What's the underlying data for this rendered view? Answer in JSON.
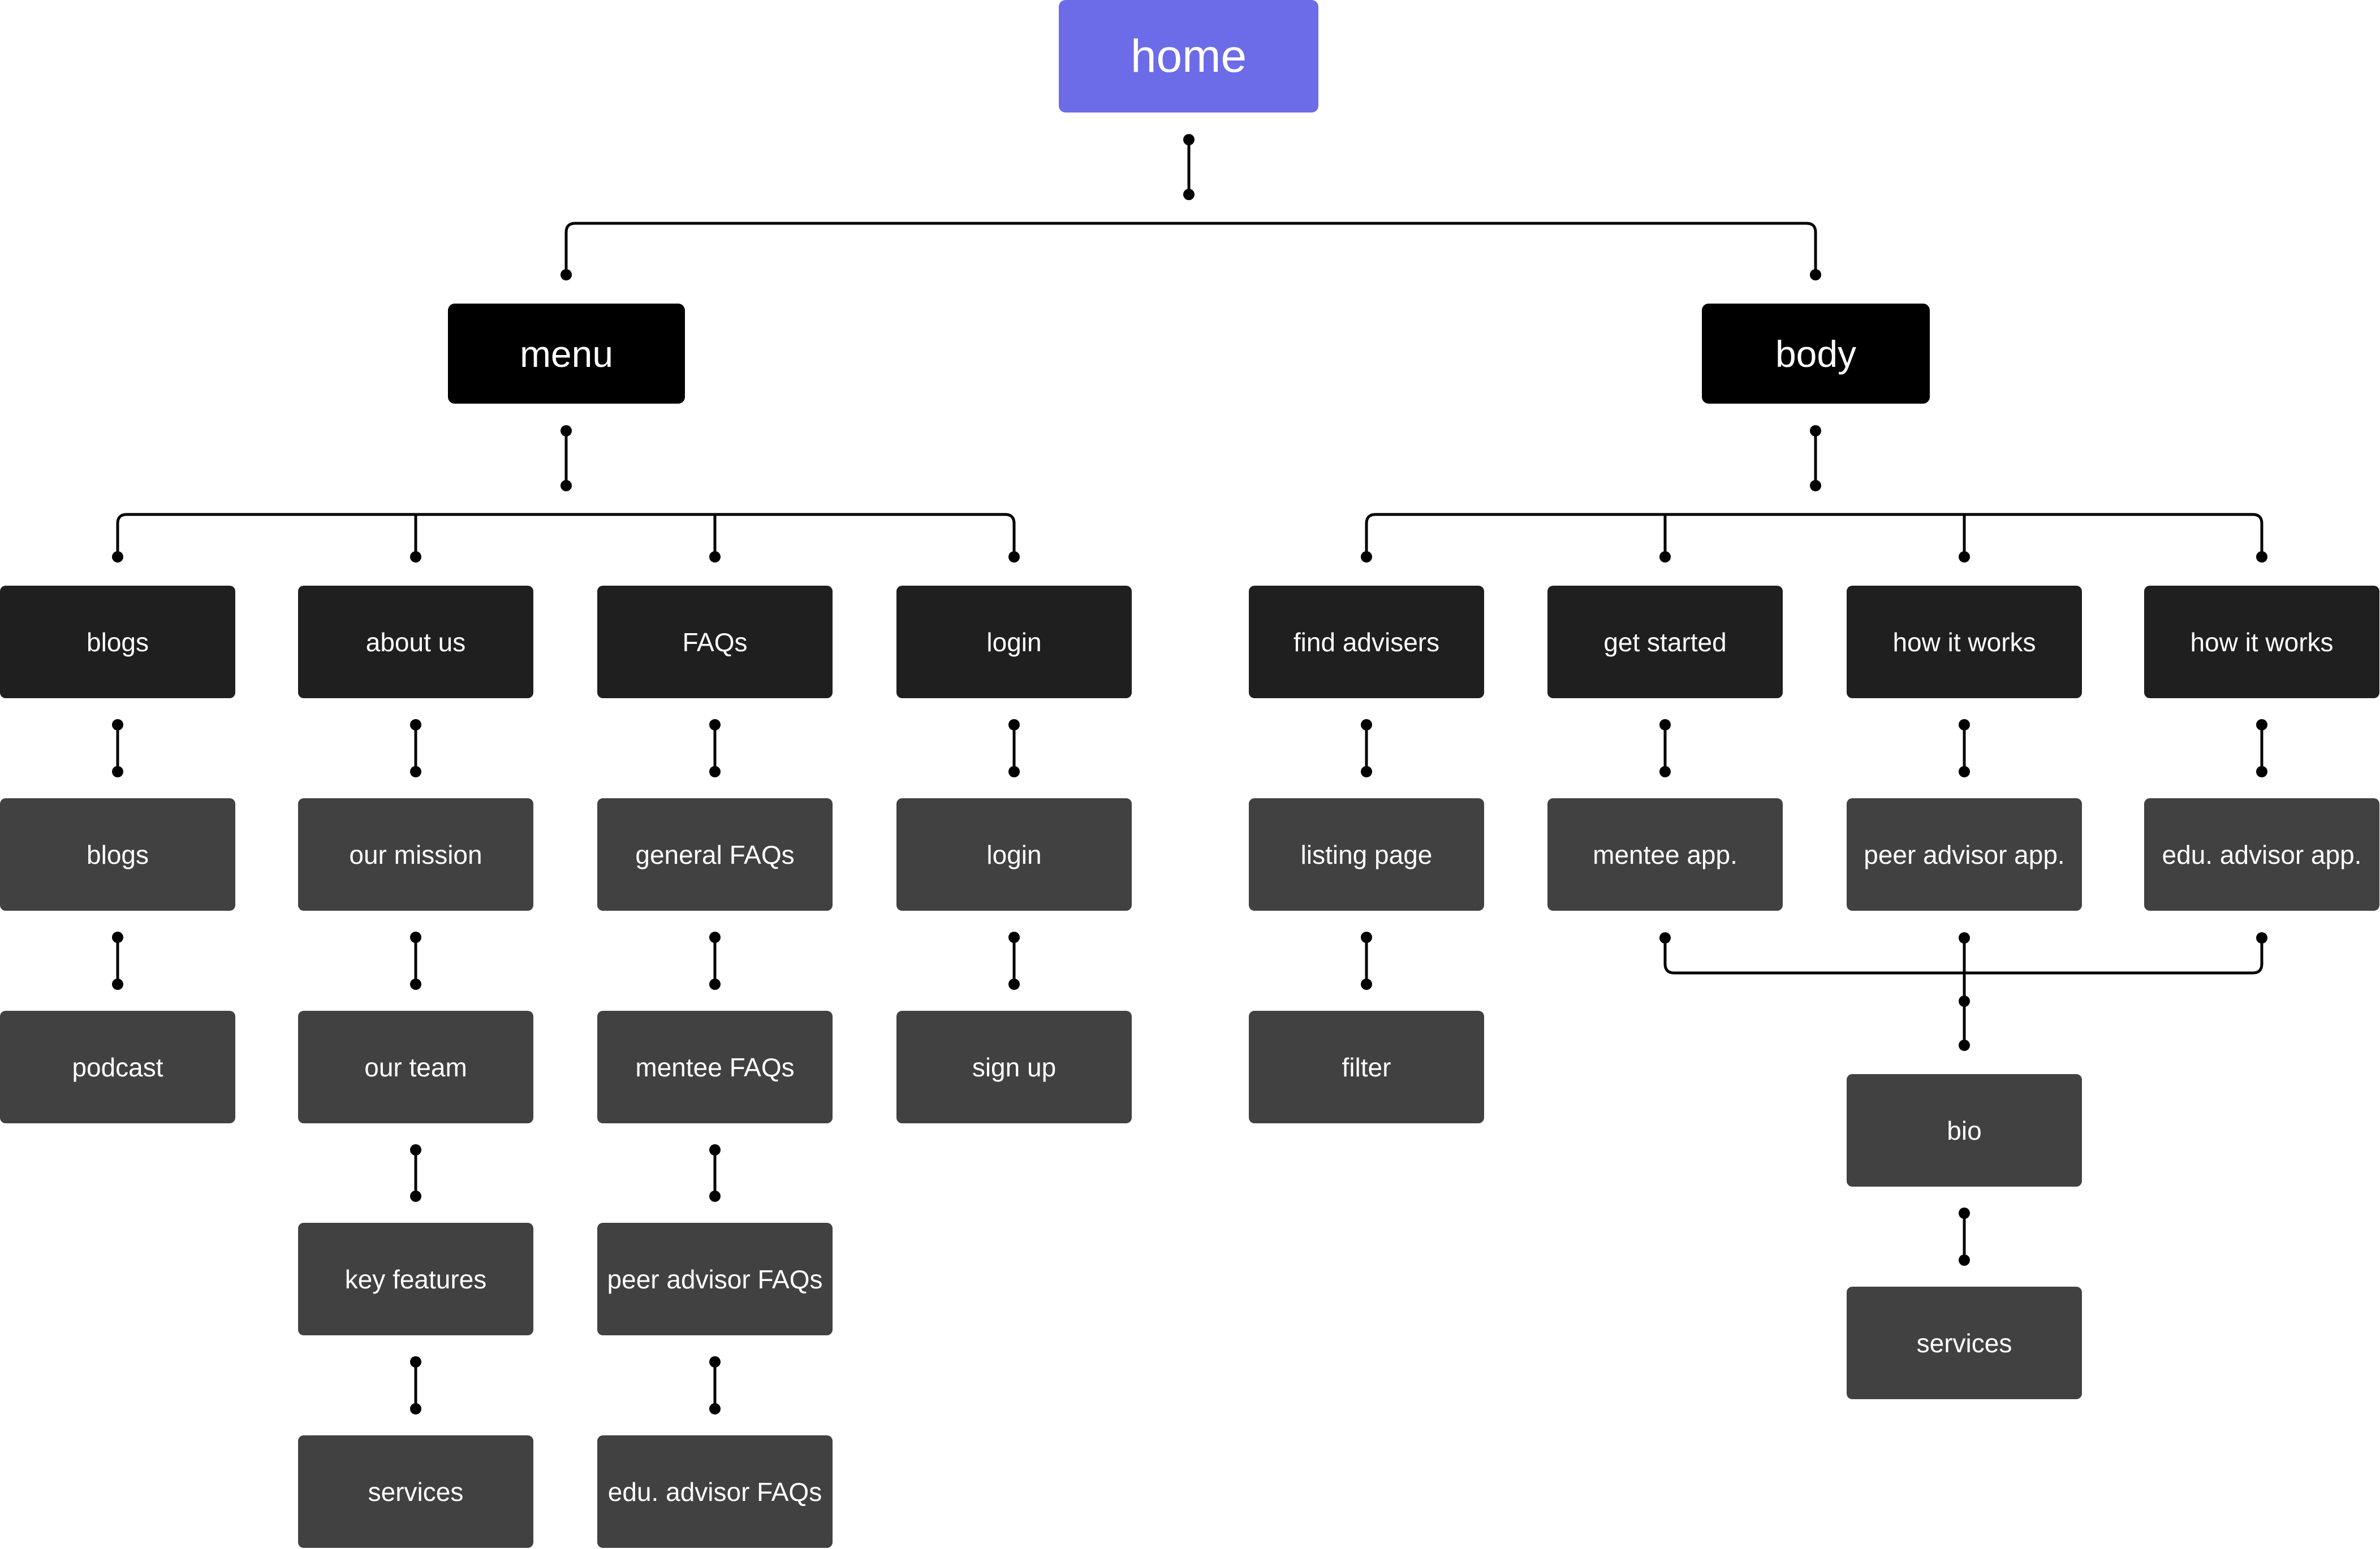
{
  "sitemap": {
    "home": "home",
    "menu": {
      "label": "menu",
      "blogs": {
        "label": "blogs",
        "children": [
          "blogs",
          "podcast"
        ]
      },
      "about_us": {
        "label": "about us",
        "children": [
          "our mission",
          "our team",
          "key features",
          "services"
        ]
      },
      "faqs": {
        "label": "FAQs",
        "children": [
          "general FAQs",
          "mentee FAQs",
          "peer advisor FAQs",
          "edu. advisor FAQs"
        ]
      },
      "login": {
        "label": "login",
        "children": [
          "login",
          "sign up"
        ]
      }
    },
    "body": {
      "label": "body",
      "find_advisers": {
        "label": "find advisers",
        "children": [
          "listing page",
          "filter"
        ]
      },
      "get_started": {
        "label": "get started",
        "children": [
          "mentee app."
        ]
      },
      "how_it_works_peer": {
        "label": "how it works",
        "children": [
          "peer advisor app."
        ]
      },
      "how_it_works_edu": {
        "label": "how it works",
        "children": [
          "edu. advisor app."
        ]
      },
      "profile": [
        "bio",
        "services"
      ]
    }
  },
  "colors": {
    "root": "#6c6ce8",
    "section": "#000000",
    "category": "#1f1f1f",
    "page": "#414141",
    "connector": "#000000"
  }
}
